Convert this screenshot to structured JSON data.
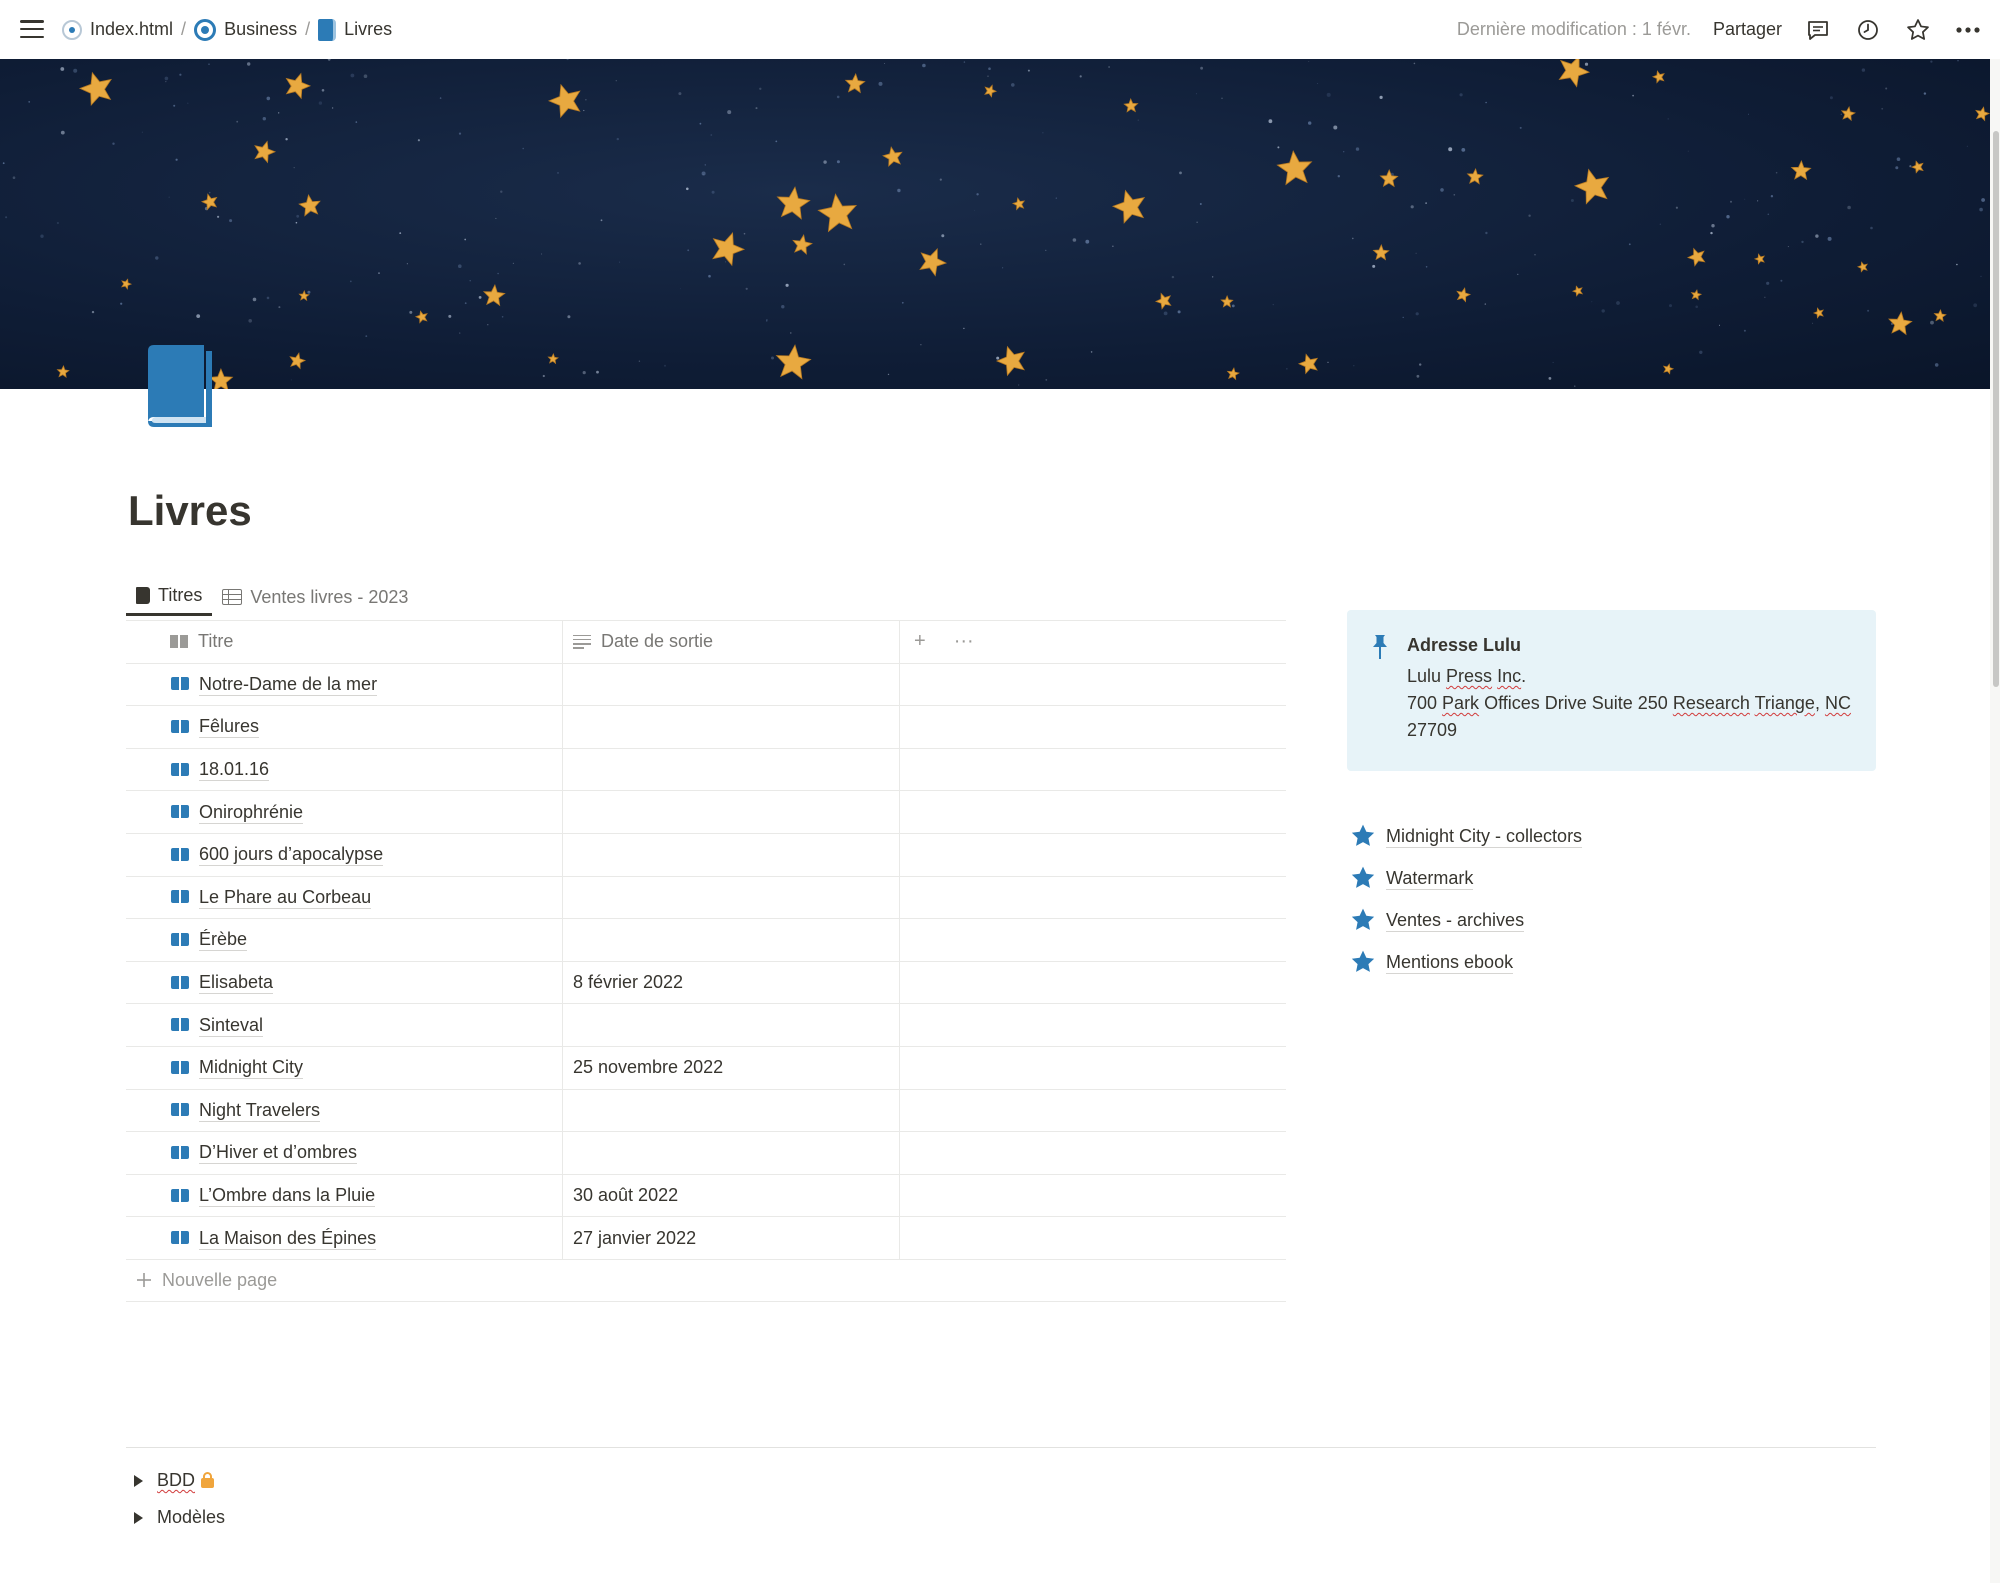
{
  "breadcrumbs": [
    {
      "label": "Index.html",
      "icon": "circle-icon"
    },
    {
      "label": "Business",
      "icon": "target-icon"
    },
    {
      "label": "Livres",
      "icon": "book-icon"
    }
  ],
  "topbar": {
    "last_modified": "Dernière modification : 1 févr.",
    "share_label": "Partager"
  },
  "page": {
    "title": "Livres",
    "icon": "book-icon"
  },
  "tabs": [
    {
      "label": "Titres",
      "active": true
    },
    {
      "label": "Ventes livres - 2023",
      "active": false
    }
  ],
  "table": {
    "columns": [
      "Titre",
      "Date de sortie"
    ],
    "add_button": "+",
    "more_button": "···",
    "rows": [
      {
        "title": "Notre-Dame de la mer",
        "date": ""
      },
      {
        "title": "Fêlures",
        "date": ""
      },
      {
        "title": "18.01.16",
        "date": ""
      },
      {
        "title": "Onirophrénie",
        "date": ""
      },
      {
        "title": "600 jours d’apocalypse",
        "date": ""
      },
      {
        "title": "Le Phare au Corbeau",
        "date": ""
      },
      {
        "title": "Érèbe",
        "date": ""
      },
      {
        "title": "Elisabeta",
        "date": "8 février 2022"
      },
      {
        "title": "Sinteval",
        "date": ""
      },
      {
        "title": "Midnight City",
        "date": "25 novembre 2022"
      },
      {
        "title": "Night Travelers",
        "date": ""
      },
      {
        "title": "D’Hiver et d’ombres",
        "date": ""
      },
      {
        "title": "L’Ombre dans la Pluie",
        "date": "30 août 2022"
      },
      {
        "title": "La Maison des Épines",
        "date": "27 janvier 2022"
      }
    ],
    "new_page_label": "Nouvelle page"
  },
  "callout": {
    "title": "Adresse Lulu",
    "line1": "Lulu Press Inc.",
    "line2": "700 Park Offices Drive Suite 250 Research Triange, NC",
    "line3": "27709"
  },
  "links": [
    {
      "label": "Midnight City - collectors"
    },
    {
      "label": "Watermark"
    },
    {
      "label": "Ventes - archives"
    },
    {
      "label": "Mentions ebook"
    }
  ],
  "toggles": [
    {
      "label": "BDD",
      "locked": true
    },
    {
      "label": "Modèles",
      "locked": false
    }
  ],
  "colors": {
    "accent": "#2c7bb6",
    "callout_bg": "#e7f3f8",
    "cover_bg": "#0f1d36",
    "star": "#e8a940"
  }
}
